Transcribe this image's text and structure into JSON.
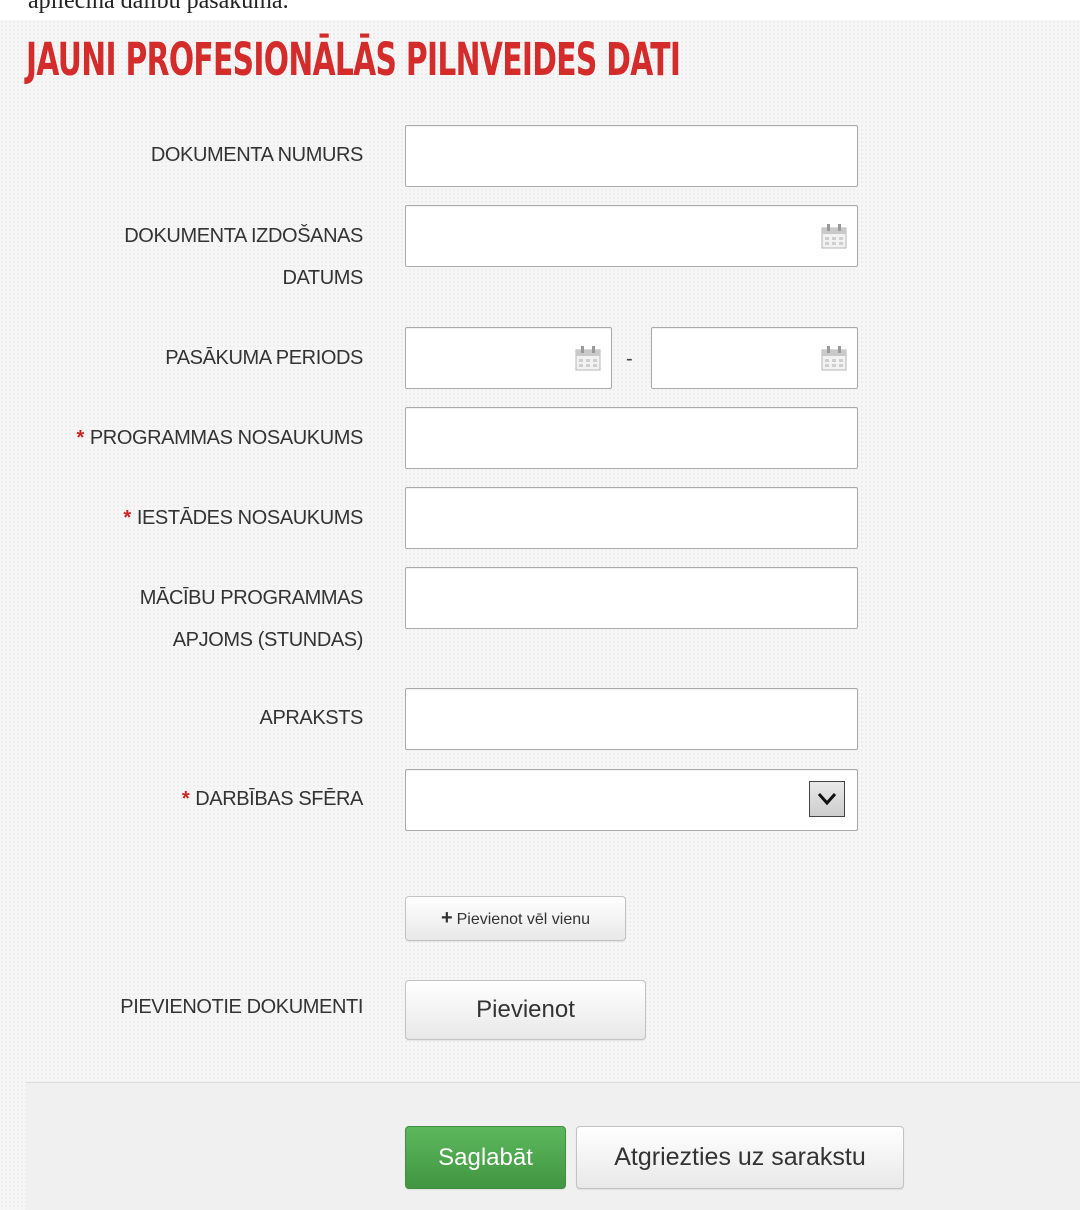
{
  "top_text": "apliecina dalību pasākumā.",
  "page_title": "JAUNI PROFESIONĀLĀS PILNVEIDES DATI",
  "required_mark": "*",
  "fields": {
    "document_number": {
      "label": "DOKUMENTA NUMURS",
      "value": ""
    },
    "issue_date": {
      "label_line1": "DOKUMENTA IZDOŠANAS",
      "label_line2": "DATUMS",
      "value": "",
      "icon": "calendar-icon"
    },
    "event_period": {
      "label": "PASĀKUMA PERIODS",
      "from": "",
      "to": "",
      "separator": "-",
      "icon": "calendar-icon"
    },
    "program_name": {
      "label": "PROGRAMMAS NOSAUKUMS",
      "required": true,
      "value": ""
    },
    "institution_name": {
      "label": "IESTĀDES NOSAUKUMS",
      "required": true,
      "value": ""
    },
    "program_volume": {
      "label_line1": "MĀCĪBU PROGRAMMAS",
      "label_line2": "APJOMS (STUNDAS)",
      "value": ""
    },
    "description": {
      "label": "APRAKSTS",
      "value": ""
    },
    "activity_sphere": {
      "label": "DARBĪBAS SFĒRA",
      "required": true,
      "selected": "",
      "icon": "chevron-down-icon"
    }
  },
  "buttons": {
    "add_another": {
      "icon": "plus-icon",
      "label": "Pievienot vēl vienu"
    },
    "attached_docs_label": "PIEVIENOTIE DOKUMENTI",
    "attach": "Pievienot",
    "save": "Saglabāt",
    "back": "Atgriezties uz sarakstu"
  },
  "colors": {
    "title": "#d42b2b",
    "required": "#cc2222",
    "save_button": "#5cb85c"
  }
}
